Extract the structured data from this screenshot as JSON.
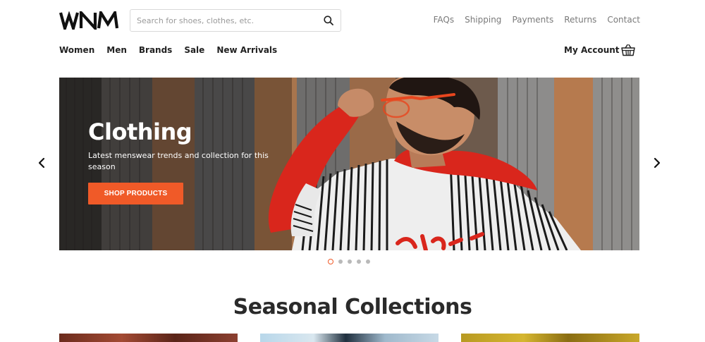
{
  "brand": {
    "logo_text": "WNM",
    "accent_color": "#f05a28"
  },
  "header": {
    "search": {
      "placeholder": "Search for shoes, clothes, etc.",
      "value": "",
      "icon": "search-icon"
    },
    "top_links": [
      "FAQs",
      "Shipping",
      "Payments",
      "Returns",
      "Contact"
    ],
    "nav": [
      "Women",
      "Men",
      "Brands",
      "Sale",
      "New Arrivals"
    ],
    "account_label": "My Account",
    "cart_icon": "shopping-basket-icon"
  },
  "hero": {
    "title": "Clothing",
    "subtitle": "Latest menswear trends and collection for this season",
    "button_label": "SHOP PRODUCTS",
    "prev_icon": "chevron-left-icon",
    "next_icon": "chevron-right-icon",
    "slide_count": 5,
    "active_slide": 1
  },
  "collections": {
    "title": "Seasonal Collections",
    "card_count": 3
  }
}
